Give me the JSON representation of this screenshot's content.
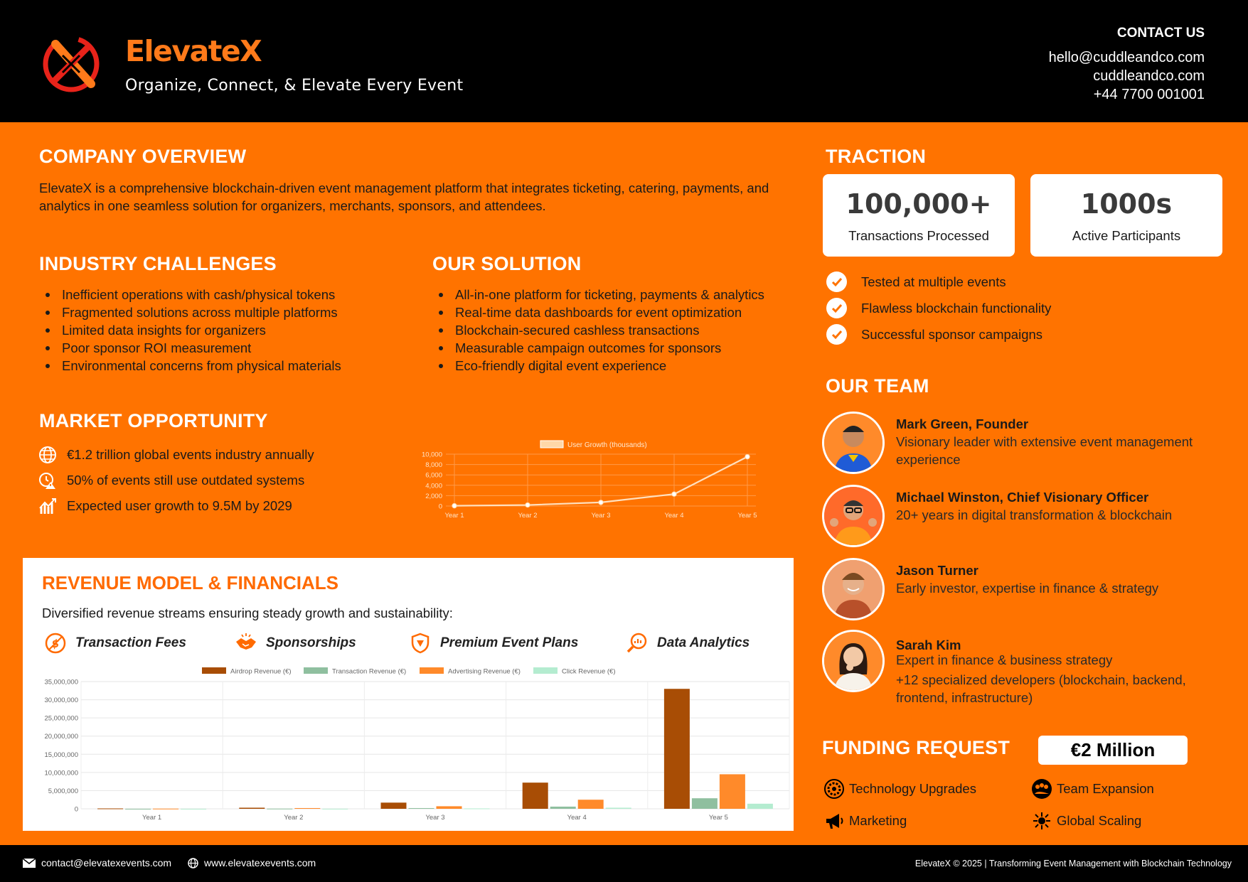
{
  "header": {
    "brand": "ElevateX",
    "tagline": "Organize, Connect, & Elevate Every Event",
    "contact_title": "CONTACT US",
    "contact_email": "hello@cuddleandco.com",
    "contact_site": "cuddleandco.com",
    "contact_phone": "+44 7700 001001"
  },
  "overview": {
    "title": "COMPANY OVERVIEW",
    "text": "ElevateX is a comprehensive blockchain-driven event management platform that integrates ticketing, catering, payments, and analytics in one seamless solution for organizers, merchants, sponsors, and attendees."
  },
  "challenges": {
    "title": "INDUSTRY CHALLENGES",
    "items": [
      "Inefficient operations with cash/physical tokens",
      "Fragmented solutions across multiple platforms",
      "Limited data insights for organizers",
      "Poor sponsor ROI measurement",
      "Environmental concerns from physical materials"
    ]
  },
  "solution": {
    "title": "OUR SOLUTION",
    "items": [
      "All-in-one platform for ticketing, payments & analytics",
      "Real-time data dashboards for event optimization",
      "Blockchain-secured cashless transactions",
      "Measurable campaign outcomes for sponsors",
      "Eco-friendly digital event experience"
    ]
  },
  "market": {
    "title": "MARKET OPPORTUNITY",
    "items": [
      {
        "icon": "globe-icon",
        "text": "€1.2 trillion global events industry annually"
      },
      {
        "icon": "clock-alert-icon",
        "text": "50% of events still use outdated systems"
      },
      {
        "icon": "growth-icon",
        "text": "Expected user growth to 9.5M by 2029"
      }
    ]
  },
  "traction": {
    "title": "TRACTION",
    "cards": [
      {
        "value": "100,000+",
        "label": "Transactions Processed"
      },
      {
        "value": "1000s",
        "label": "Active Participants"
      }
    ],
    "checks": [
      "Tested at multiple events",
      "Flawless blockchain functionality",
      "Successful sponsor campaigns"
    ]
  },
  "team": {
    "title": "OUR TEAM",
    "members": [
      {
        "name": "Mark Green, Founder",
        "desc": "Visionary leader with extensive event management experience"
      },
      {
        "name": "Michael Winston, Chief Visionary Officer",
        "desc": "20+ years in digital transformation & blockchain"
      },
      {
        "name": "Jason Turner",
        "desc": "Early investor, expertise in finance & strategy"
      },
      {
        "name": "Sarah Kim",
        "desc": "Expert in finance & business strategy"
      }
    ],
    "extra": "+12 specialized developers (blockchain, backend, frontend, infrastructure)"
  },
  "funding": {
    "title": "FUNDING REQUEST",
    "amount": "€2 Million",
    "items": [
      {
        "icon": "gear-icon",
        "text": "Technology Upgrades"
      },
      {
        "icon": "team-icon",
        "text": "Team Expansion"
      },
      {
        "icon": "megaphone-icon",
        "text": "Marketing"
      },
      {
        "icon": "network-icon",
        "text": "Global Scaling"
      }
    ]
  },
  "revenue": {
    "title": "REVENUE MODEL & FINANCIALS",
    "subtitle": "Diversified revenue streams ensuring steady growth and sustainability:",
    "streams": [
      {
        "icon": "dollar-icon",
        "text": "Transaction Fees"
      },
      {
        "icon": "handshake-icon",
        "text": "Sponsorships"
      },
      {
        "icon": "badge-icon",
        "text": "Premium Event Plans"
      },
      {
        "icon": "analytics-icon",
        "text": "Data Analytics"
      }
    ]
  },
  "colors": {
    "accent": "#ff7300",
    "black": "#000000",
    "airdrop": "#a84d05",
    "transaction": "#8fbf9f",
    "advertising": "#ff8a2a",
    "click": "#b4ecd0"
  },
  "chart_data": [
    {
      "type": "line",
      "categories": [
        "Year 1",
        "Year 2",
        "Year 3",
        "Year 4",
        "Year 5"
      ],
      "series": [
        {
          "name": "User Growth (thousands)",
          "values": [
            50,
            200,
            700,
            2300,
            9500
          ]
        }
      ],
      "ylim": [
        0,
        10000
      ],
      "yticks": [
        "0",
        "2,000",
        "4,000",
        "6,000",
        "8,000",
        "10,000"
      ],
      "legend": "top",
      "grid": true
    },
    {
      "type": "bar",
      "categories": [
        "Year 1",
        "Year 2",
        "Year 3",
        "Year 4",
        "Year 5"
      ],
      "series": [
        {
          "name": "Airdrop Revenue (€)",
          "values": [
            100000,
            300000,
            1700000,
            7200000,
            33000000
          ]
        },
        {
          "name": "Transaction Revenue (€)",
          "values": [
            10000,
            50000,
            200000,
            600000,
            2900000
          ]
        },
        {
          "name": "Advertising Revenue (€)",
          "values": [
            50000,
            200000,
            700000,
            2500000,
            9500000
          ]
        },
        {
          "name": "Click Revenue (€)",
          "values": [
            5000,
            20000,
            100000,
            300000,
            1400000
          ]
        }
      ],
      "ylim": [
        0,
        35000000
      ],
      "yticks": [
        "0",
        "5,000,000",
        "10,000,000",
        "15,000,000",
        "20,000,000",
        "25,000,000",
        "30,000,000",
        "35,000,000"
      ],
      "legend": "top",
      "grid": true
    }
  ],
  "footer": {
    "email": "contact@elevatexevents.com",
    "site": "www.elevatexevents.com",
    "copyright": "ElevateX © 2025 | Transforming Event Management with Blockchain Technology"
  }
}
